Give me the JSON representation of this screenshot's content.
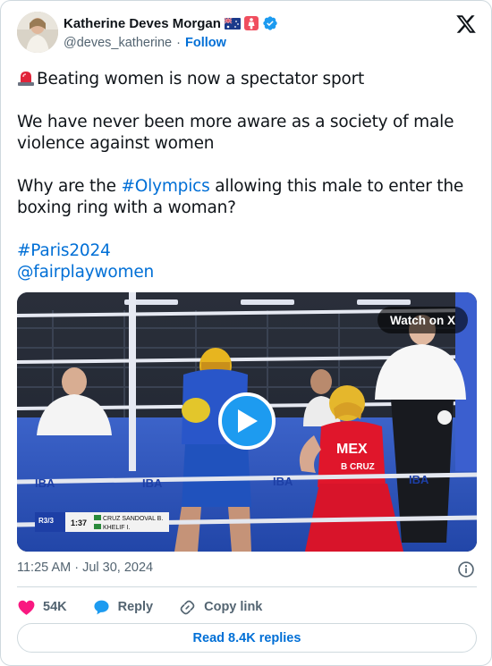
{
  "author": {
    "name": "Katherine Deves Morgan",
    "handle": "@deves_katherine",
    "follow_label": "Follow"
  },
  "tweet": {
    "line1": "Beating women is now a spectator sport",
    "line2": "We have never been more aware as a society of male violence against women",
    "line3_prefix": "Why are the ",
    "line3_hashtag": "#Olympics",
    "line3_suffix": " allowing this male to enter the boxing ring with a woman?",
    "hashtag2": "#Paris2024",
    "mention": "@fairplaywomen"
  },
  "media": {
    "watch_label": "Watch on X",
    "scoreboard_round": "R3/3",
    "scoreboard_time": "1:37",
    "scoreboard_fighter1": "CRUZ SANDOVAL B.",
    "scoreboard_fighter2": "KHELIF I.",
    "shirt_country": "MEX",
    "shirt_name": "B CRUZ",
    "banner_text": "IBA",
    "accent": "#1d9bf0"
  },
  "meta": {
    "timestamp": "11:25 AM · Jul 30, 2024"
  },
  "actions": {
    "likes": "54K",
    "reply_label": "Reply",
    "copy_label": "Copy link"
  },
  "footer": {
    "read_replies": "Read 8.4K replies"
  },
  "colors": {
    "link": "#006fd6",
    "heart": "#f91880",
    "reply_bubble": "#1d9bf0",
    "muted": "#536471"
  }
}
